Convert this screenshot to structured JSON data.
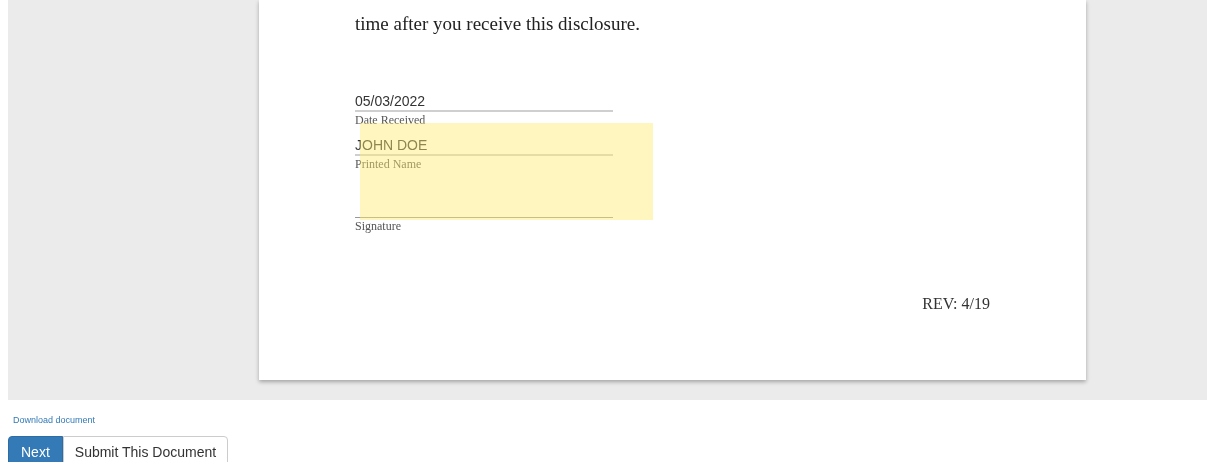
{
  "document": {
    "body_text": "time after you receive this disclosure.",
    "fields": [
      {
        "kind": "text",
        "value": "05/03/2022",
        "label": "Date Received"
      },
      {
        "kind": "text",
        "value": "JOHN DOE",
        "label": "Printed Name"
      },
      {
        "kind": "signature",
        "label": "Signature"
      }
    ],
    "revision": "REV: 4/19"
  },
  "download_link": "Download document",
  "buttons": [
    {
      "label": "Next",
      "kind": "primary"
    },
    {
      "label": "Submit This Document",
      "kind": "default"
    }
  ]
}
